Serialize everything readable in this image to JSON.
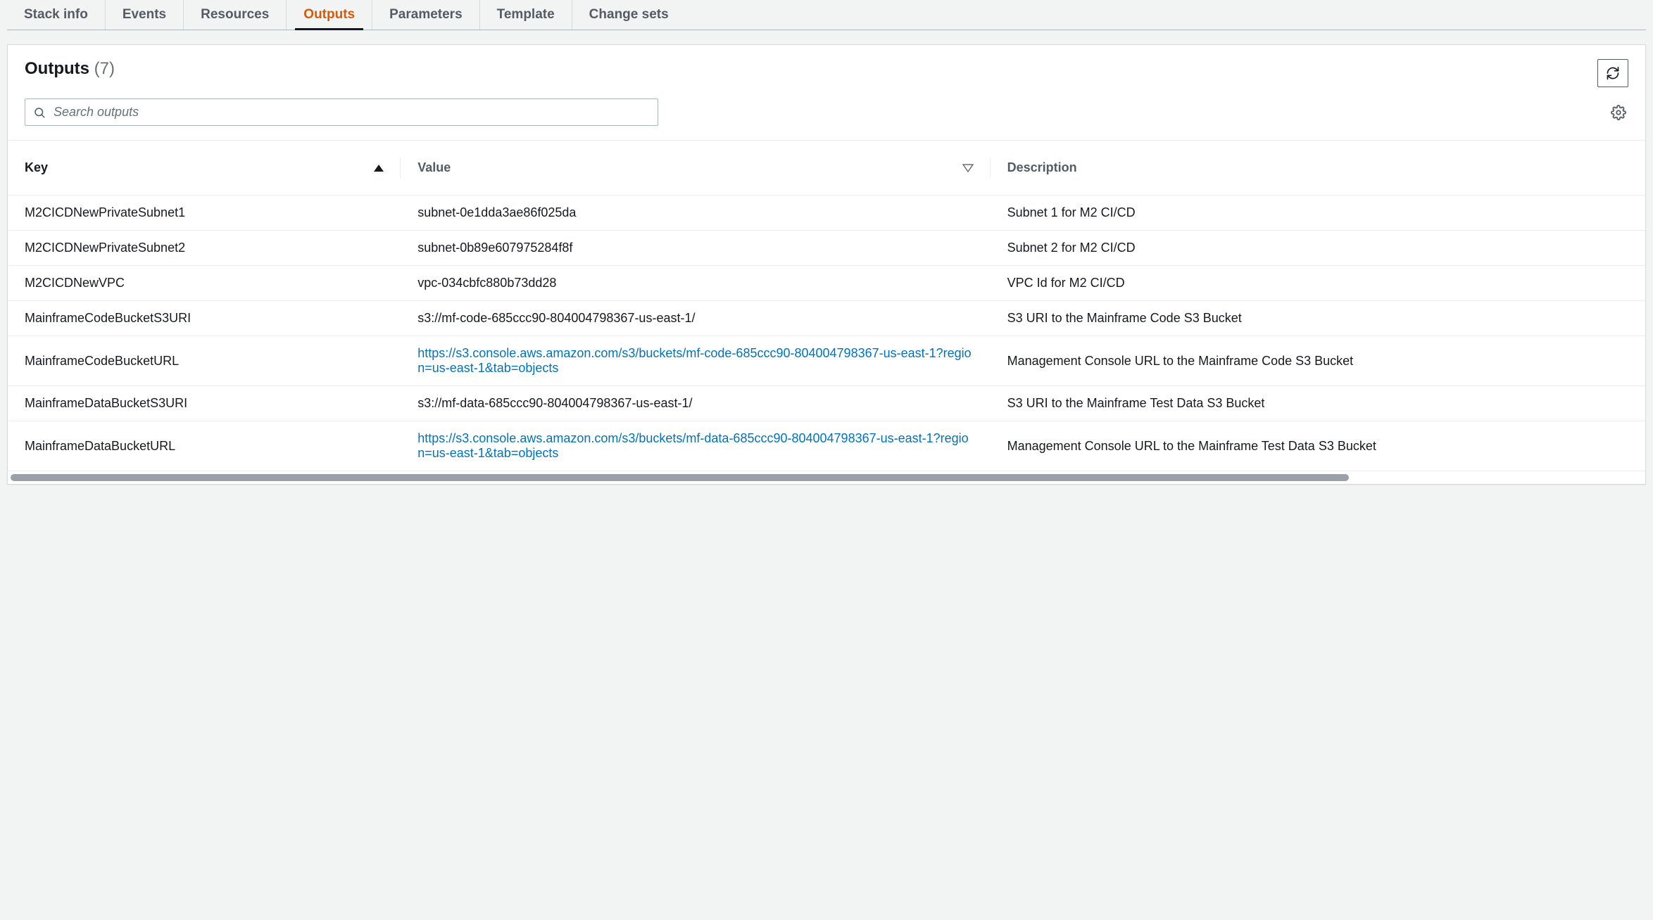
{
  "tabs": [
    {
      "label": "Stack info",
      "active": false
    },
    {
      "label": "Events",
      "active": false
    },
    {
      "label": "Resources",
      "active": false
    },
    {
      "label": "Outputs",
      "active": true
    },
    {
      "label": "Parameters",
      "active": false
    },
    {
      "label": "Template",
      "active": false
    },
    {
      "label": "Change sets",
      "active": false
    }
  ],
  "panel": {
    "title": "Outputs",
    "count": "(7)"
  },
  "search": {
    "placeholder": "Search outputs"
  },
  "columns": {
    "key": "Key",
    "value": "Value",
    "description": "Description"
  },
  "rows": [
    {
      "key": "M2CICDNewPrivateSubnet1",
      "value": "subnet-0e1dda3ae86f025da",
      "link": false,
      "description": "Subnet 1 for M2 CI/CD"
    },
    {
      "key": "M2CICDNewPrivateSubnet2",
      "value": "subnet-0b89e607975284f8f",
      "link": false,
      "description": "Subnet 2 for M2 CI/CD"
    },
    {
      "key": "M2CICDNewVPC",
      "value": "vpc-034cbfc880b73dd28",
      "link": false,
      "description": "VPC Id for M2 CI/CD"
    },
    {
      "key": "MainframeCodeBucketS3URI",
      "value": "s3://mf-code-685ccc90-804004798367-us-east-1/",
      "link": false,
      "description": "S3 URI to the Mainframe Code S3 Bucket"
    },
    {
      "key": "MainframeCodeBucketURL",
      "value": "https://s3.console.aws.amazon.com/s3/buckets/mf-code-685ccc90-804004798367-us-east-1?region=us-east-1&tab=objects",
      "link": true,
      "description": "Management Console URL to the Mainframe Code S3 Bucket"
    },
    {
      "key": "MainframeDataBucketS3URI",
      "value": "s3://mf-data-685ccc90-804004798367-us-east-1/",
      "link": false,
      "description": "S3 URI to the Mainframe Test Data S3 Bucket"
    },
    {
      "key": "MainframeDataBucketURL",
      "value": "https://s3.console.aws.amazon.com/s3/buckets/mf-data-685ccc90-804004798367-us-east-1?region=us-east-1&tab=objects",
      "link": true,
      "description": "Management Console URL to the Mainframe Test Data S3 Bucket"
    }
  ]
}
